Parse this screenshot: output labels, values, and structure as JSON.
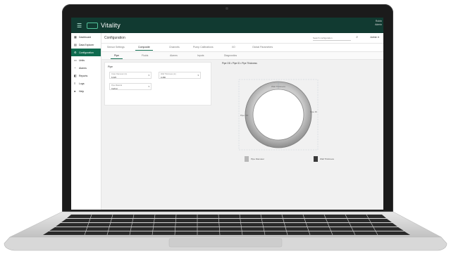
{
  "app": {
    "name": "Vitality",
    "user_line1": "Robin",
    "user_line2": "Admin",
    "brand_color": "#113a31",
    "accent_color": "#0f6b4f"
  },
  "sidebar": {
    "items": [
      {
        "label": "Dashboard",
        "icon": "grid-icon",
        "active": false
      },
      {
        "label": "Data Explorer",
        "icon": "table-icon",
        "active": false
      },
      {
        "label": "Configuration",
        "icon": "settings-icon",
        "active": true
      },
      {
        "label": "Units",
        "icon": "ruler-icon",
        "active": false
      },
      {
        "label": "Alarms",
        "icon": "bell-icon",
        "active": false
      },
      {
        "label": "Reports",
        "icon": "report-icon",
        "active": false
      },
      {
        "label": "Logs",
        "icon": "list-icon",
        "active": false
      },
      {
        "label": "Help",
        "icon": "help-icon",
        "active": false
      }
    ]
  },
  "header": {
    "title": "Configuration",
    "search_placeholder": "Search configuration",
    "user_menu": "Admin ▾"
  },
  "tabs": [
    {
      "label": "Sensor Settings",
      "active": false
    },
    {
      "label": "Composite",
      "active": true
    },
    {
      "label": "Channels",
      "active": false
    },
    {
      "label": "Pump Calibrations",
      "active": false
    },
    {
      "label": "I/O",
      "active": false
    },
    {
      "label": "Global Parameters",
      "active": false
    }
  ],
  "subtabs": [
    {
      "label": "Pipe",
      "active": true
    },
    {
      "label": "Fluids",
      "active": false
    },
    {
      "label": "Alarms",
      "active": false
    },
    {
      "label": "Inputs",
      "active": false
    },
    {
      "label": "Diagnostics",
      "active": false
    }
  ],
  "form": {
    "title": "Pipe",
    "fields": [
      {
        "label": "Outer Diameter (in)",
        "value": "6.625"
      },
      {
        "label": "Wall Thickness (in)",
        "value": "0.280"
      },
      {
        "label": "Pipe Material",
        "value": "Carbon"
      }
    ]
  },
  "chart": {
    "title": "Pipe OD • Pipe ID • Pipe Thickness",
    "dim_top": "Wall Thickness",
    "dim_left": "Pipe OD",
    "dim_right": "Pipe ID",
    "legend": [
      {
        "label": "Pipe Diameter",
        "color": "#b8b8b8"
      },
      {
        "label": "Wall Thickness",
        "color": "#3a3a3a"
      }
    ]
  }
}
